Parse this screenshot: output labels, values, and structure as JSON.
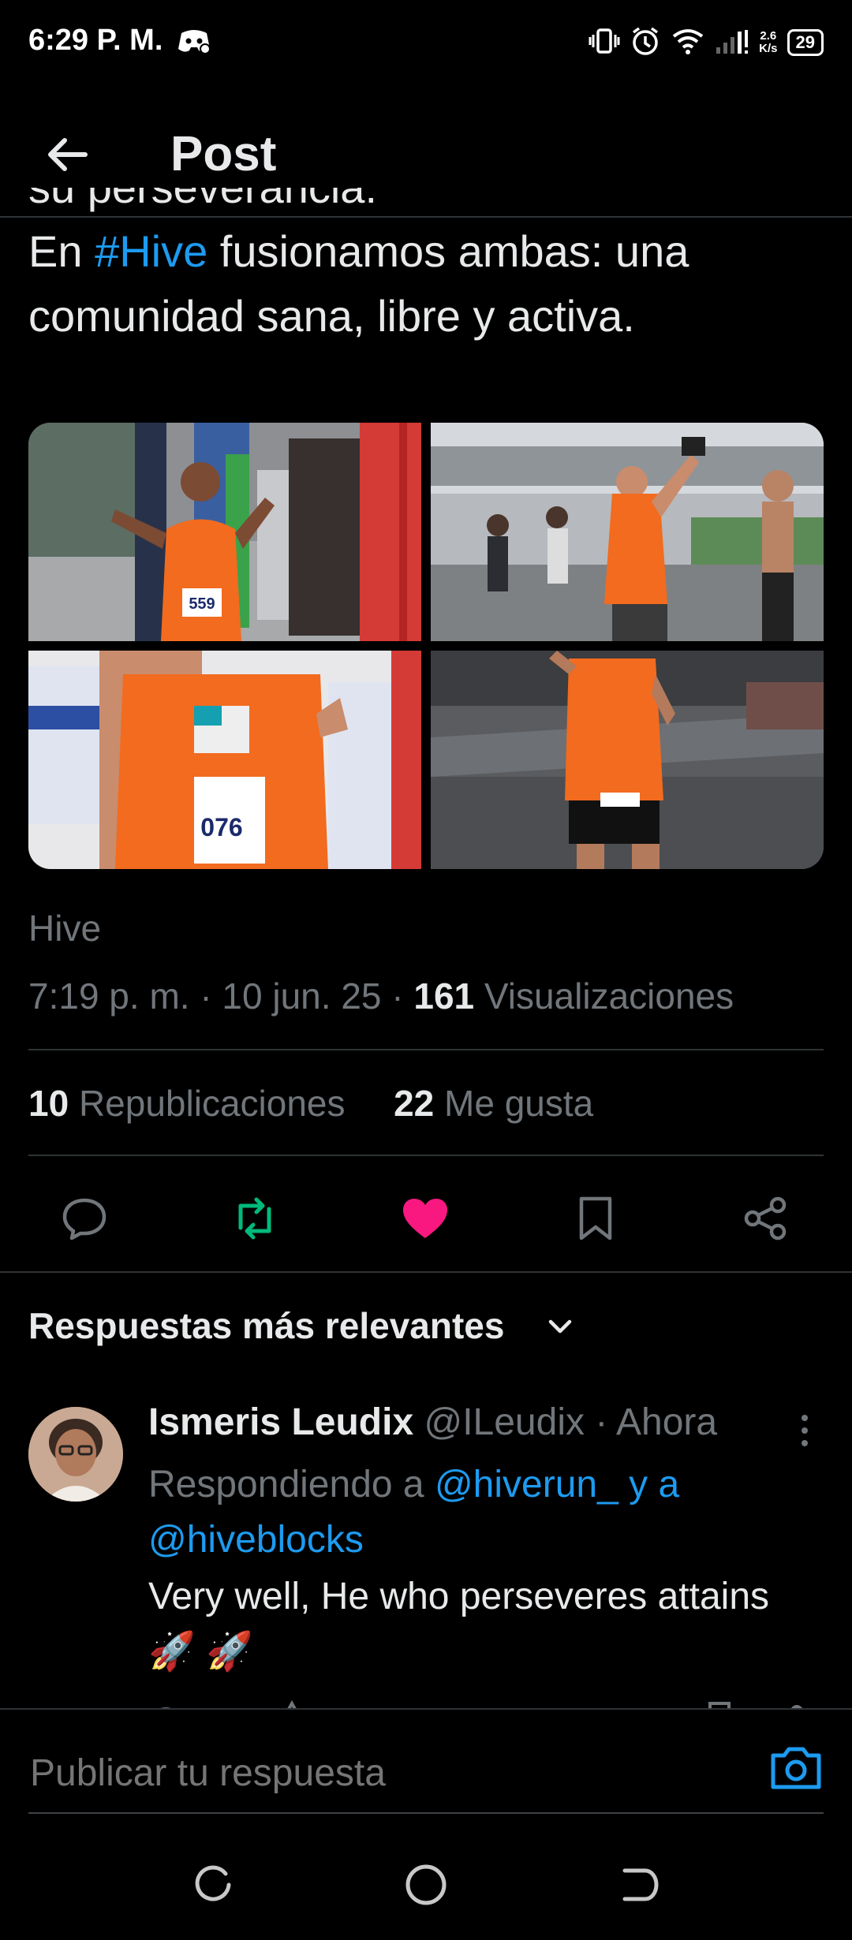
{
  "status_bar": {
    "time": "6:29 P. M.",
    "net_speed_value": "2.6",
    "net_speed_unit": "K/s",
    "battery": "29"
  },
  "header": {
    "title": "Post"
  },
  "tweet": {
    "text_cut": "su perseverancia.",
    "text_pre": "En ",
    "hashtag": "#Hive",
    "text_post": " fusionamos ambas: una comunidad sana, libre y activa.",
    "media": [
      {
        "bib": "559"
      },
      {
        "bib": ""
      },
      {
        "bib": "076"
      },
      {
        "bib": ""
      }
    ],
    "source": "Hive",
    "timestamp": "7:19 p. m. · 10 jun. 25 · ",
    "views_count": "161",
    "views_label": " Visualizaciones",
    "reposts_count": "10",
    "reposts_label": " Republicaciones",
    "likes_count": "22",
    "likes_label": " Me gusta"
  },
  "colors": {
    "accent": "#1d9bf0",
    "repost": "#00ba7c",
    "like": "#f91880",
    "muted": "#71767b"
  },
  "replies": {
    "title": "Respuestas más relevantes",
    "items": [
      {
        "name": "Ismeris Leudix",
        "handle": " @ILeudix · Ahora",
        "replying_prefix": "Respondiendo a ",
        "replying_to_1": "@hiverun_ y a",
        "replying_to_2": "@hiveblocks",
        "text": "Very well, He who perseveres attains",
        "emoji": "🚀 🚀"
      }
    ]
  },
  "composer": {
    "placeholder": "Publicar tu respuesta"
  }
}
